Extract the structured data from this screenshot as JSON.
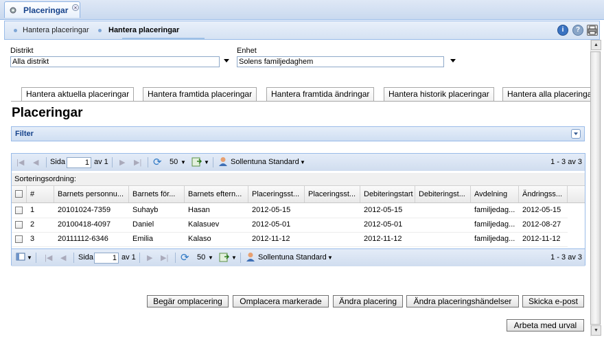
{
  "app_tab": {
    "title": "Placeringar"
  },
  "breadcrumb": {
    "item1": "Hantera placeringar",
    "item2": "Hantera placeringar"
  },
  "header_icons": [
    "info-icon",
    "help-icon",
    "print-icon"
  ],
  "form": {
    "distrikt_label": "Distrikt",
    "distrikt_value": "Alla distrikt",
    "enhet_label": "Enhet",
    "enhet_value": "Solens familjedaghem"
  },
  "tabs": [
    "Hantera aktuella placeringar",
    "Hantera framtida placeringar",
    "Hantera framtida ändringar",
    "Hantera historik placeringar",
    "Hantera alla placeringar"
  ],
  "page_title": "Placeringar",
  "filter": {
    "label": "Filter"
  },
  "paging": {
    "page_label": "Sida",
    "page_value": "1",
    "of_label": "av 1",
    "page_size": "50",
    "view_label": "Sollentuna Standard",
    "range": "1 - 3 av 3"
  },
  "sort_label": "Sorteringsordning:",
  "columns": [
    "#",
    "Barnets personnu...",
    "Barnets för...",
    "Barnets eftern...",
    "Placeringsst...",
    "Placeringsst...",
    "Debiteringstart",
    "Debiteringst...",
    "Avdelning",
    "Ändringss..."
  ],
  "rows": [
    [
      "1",
      "20101024-7359",
      "Suhayb",
      "Hasan",
      "2012-05-15",
      "",
      "2012-05-15",
      "",
      "familjedag...",
      "2012-05-15"
    ],
    [
      "2",
      "20100418-4097",
      "Daniel",
      "Kalasuev",
      "2012-05-01",
      "",
      "2012-05-01",
      "",
      "familjedag...",
      "2012-08-27"
    ],
    [
      "3",
      "20111112-6346",
      "Emilia",
      "Kalaso",
      "2012-11-12",
      "",
      "2012-11-12",
      "",
      "familjedag...",
      "2012-11-12"
    ]
  ],
  "buttons": {
    "begar": "Begär omplacering",
    "omplacera": "Omplacera markerade",
    "andra": "Ändra placering",
    "handelser": "Ändra placeringshändelser",
    "skicka": "Skicka e-post",
    "urval": "Arbeta med urval"
  },
  "colors": {
    "accent": "#15428b",
    "border": "#99bbe8"
  }
}
